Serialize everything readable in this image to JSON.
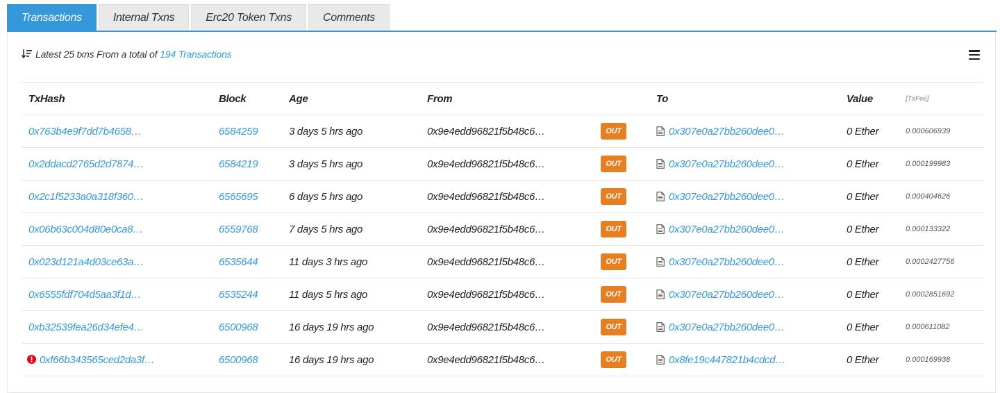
{
  "tabs": [
    {
      "label": "Transactions",
      "active": true
    },
    {
      "label": "Internal Txns",
      "active": false
    },
    {
      "label": "Erc20 Token Txns",
      "active": false
    },
    {
      "label": "Comments",
      "active": false
    }
  ],
  "summary": {
    "prefix": "Latest 25 txns From a total of",
    "link_text": "194 Transactions"
  },
  "table": {
    "headers": {
      "txhash": "TxHash",
      "block": "Block",
      "age": "Age",
      "from": "From",
      "to": "To",
      "value": "Value",
      "txfee": "[TxFee]"
    },
    "rows": [
      {
        "hash": "0x763b4e9f7dd7b4658…",
        "block": "6584259",
        "age": "3 days 5 hrs ago",
        "from": "0x9e4edd96821f5b48c6…",
        "direction": "OUT",
        "to": "0x307e0a27bb260dee0…",
        "value": "0 Ether",
        "fee": "0.000606939",
        "error": false
      },
      {
        "hash": "0x2ddacd2765d2d7874…",
        "block": "6584219",
        "age": "3 days 5 hrs ago",
        "from": "0x9e4edd96821f5b48c6…",
        "direction": "OUT",
        "to": "0x307e0a27bb260dee0…",
        "value": "0 Ether",
        "fee": "0.000199983",
        "error": false
      },
      {
        "hash": "0x2c1f5233a0a318f360…",
        "block": "6565695",
        "age": "6 days 5 hrs ago",
        "from": "0x9e4edd96821f5b48c6…",
        "direction": "OUT",
        "to": "0x307e0a27bb260dee0…",
        "value": "0 Ether",
        "fee": "0.000404626",
        "error": false
      },
      {
        "hash": "0x06b63c004d80e0ca8…",
        "block": "6559768",
        "age": "7 days 5 hrs ago",
        "from": "0x9e4edd96821f5b48c6…",
        "direction": "OUT",
        "to": "0x307e0a27bb260dee0…",
        "value": "0 Ether",
        "fee": "0.000133322",
        "error": false
      },
      {
        "hash": "0x023d121a4d03ce63a…",
        "block": "6535644",
        "age": "11 days 3 hrs ago",
        "from": "0x9e4edd96821f5b48c6…",
        "direction": "OUT",
        "to": "0x307e0a27bb260dee0…",
        "value": "0 Ether",
        "fee": "0.0002427756",
        "error": false
      },
      {
        "hash": "0x6555fdf704d5aa3f1d…",
        "block": "6535244",
        "age": "11 days 5 hrs ago",
        "from": "0x9e4edd96821f5b48c6…",
        "direction": "OUT",
        "to": "0x307e0a27bb260dee0…",
        "value": "0 Ether",
        "fee": "0.0002851692",
        "error": false
      },
      {
        "hash": "0xb32539fea26d34efe4…",
        "block": "6500968",
        "age": "16 days 19 hrs ago",
        "from": "0x9e4edd96821f5b48c6…",
        "direction": "OUT",
        "to": "0x307e0a27bb260dee0…",
        "value": "0 Ether",
        "fee": "0.000611082",
        "error": false
      },
      {
        "hash": "0xf66b343565ced2da3f…",
        "block": "6500968",
        "age": "16 days 19 hrs ago",
        "from": "0x9e4edd96821f5b48c6…",
        "direction": "OUT",
        "to": "0x8fe19c447821b4cdcd…",
        "value": "0 Ether",
        "fee": "0.000169938",
        "error": true
      }
    ]
  },
  "icons": {
    "sort": "sort-descending-icon",
    "menu": "hamburger-menu-icon",
    "error": "error-exclamation-icon",
    "contract": "contract-document-icon"
  },
  "colors": {
    "accent": "#3498db",
    "out_badge": "#e67e22",
    "error": "#e3051b"
  }
}
